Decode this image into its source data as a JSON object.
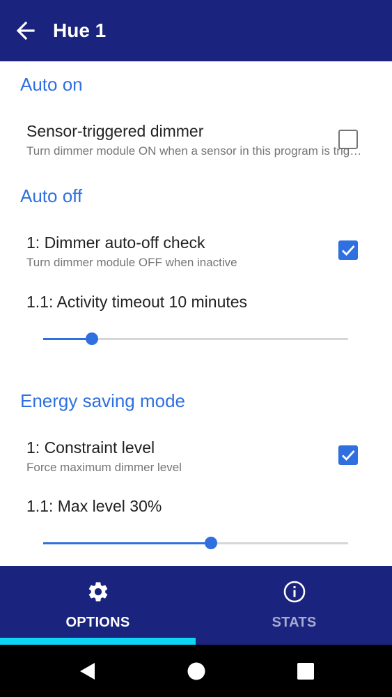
{
  "appbar": {
    "title": "Hue 1",
    "back_icon": "arrow-back-icon"
  },
  "sections": {
    "auto_on": {
      "header": "Auto on",
      "sensor_dimmer": {
        "title": "Sensor-triggered dimmer",
        "summary": "Turn dimmer module ON when a sensor in this program is triggered",
        "checked": false
      }
    },
    "auto_off": {
      "header": "Auto off",
      "auto_off_check": {
        "title": "1: Dimmer auto-off check",
        "summary": "Turn dimmer module OFF when inactive",
        "checked": true
      },
      "activity_timeout": {
        "title": "1.1: Activity timeout 10 minutes",
        "slider_fraction": 0.16
      }
    },
    "energy_saving": {
      "header": "Energy saving mode",
      "constraint_level": {
        "title": "1: Constraint level",
        "summary": "Force maximum dimmer level",
        "checked": true
      },
      "max_level": {
        "title": "1.1: Max level 30%",
        "slider_fraction": 0.55
      }
    }
  },
  "bottom_nav": {
    "tabs": [
      {
        "label": "OPTIONS",
        "icon": "gear-icon",
        "selected": true
      },
      {
        "label": "STATS",
        "icon": "info-icon",
        "selected": false
      }
    ]
  },
  "system_nav": {
    "back_icon": "triangle-back-icon",
    "home_icon": "circle-home-icon",
    "recents_icon": "square-recents-icon"
  },
  "colors": {
    "primary": "#1a237e",
    "accent": "#2f6fe0",
    "indicator": "#0fd5f5"
  }
}
